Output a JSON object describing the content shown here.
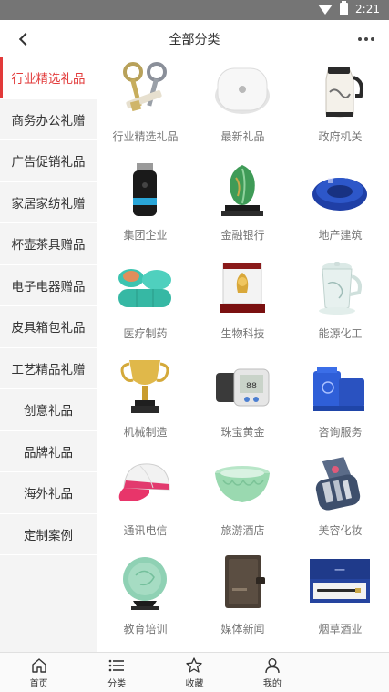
{
  "status": {
    "time": "2:21"
  },
  "header": {
    "title": "全部分类"
  },
  "sidebar": {
    "items": [
      {
        "label": "行业精选礼品",
        "active": true
      },
      {
        "label": "商务办公礼赠"
      },
      {
        "label": "广告促销礼品"
      },
      {
        "label": "家居家纺礼赠"
      },
      {
        "label": "杯壶茶具赠品"
      },
      {
        "label": "电子电器赠品"
      },
      {
        "label": "皮具箱包礼品"
      },
      {
        "label": "工艺精品礼赠"
      },
      {
        "label": "创意礼品"
      },
      {
        "label": "品牌礼品"
      },
      {
        "label": "海外礼品"
      },
      {
        "label": "定制案例"
      }
    ]
  },
  "grid": {
    "items": [
      {
        "label": "行业精选礼品",
        "icon": "keys-gift-icon"
      },
      {
        "label": "最新礼品",
        "icon": "white-device-icon"
      },
      {
        "label": "政府机关",
        "icon": "kettle-icon"
      },
      {
        "label": "集团企业",
        "icon": "usb-lighter-icon"
      },
      {
        "label": "金融银行",
        "icon": "jade-cabbage-icon"
      },
      {
        "label": "地产建筑",
        "icon": "ashtray-icon"
      },
      {
        "label": "医疗制药",
        "icon": "pill-box-icon"
      },
      {
        "label": "生物科技",
        "icon": "gold-ornament-icon"
      },
      {
        "label": "能源化工",
        "icon": "tea-cup-icon"
      },
      {
        "label": "机械制造",
        "icon": "trophy-icon"
      },
      {
        "label": "珠宝黄金",
        "icon": "blood-pressure-meter-icon"
      },
      {
        "label": "咨询服务",
        "icon": "pen-holder-icon"
      },
      {
        "label": "通讯电信",
        "icon": "cap-icon"
      },
      {
        "label": "旅游酒店",
        "icon": "green-bowl-icon"
      },
      {
        "label": "美容化妆",
        "icon": "manicure-set-icon"
      },
      {
        "label": "教育培训",
        "icon": "celadon-plate-icon"
      },
      {
        "label": "媒体新闻",
        "icon": "notebook-icon"
      },
      {
        "label": "烟草酒业",
        "icon": "pen-box-icon"
      }
    ]
  },
  "bottom_nav": {
    "items": [
      {
        "label": "首页",
        "icon": "home-icon"
      },
      {
        "label": "分类",
        "icon": "list-icon"
      },
      {
        "label": "收藏",
        "icon": "star-icon"
      },
      {
        "label": "我的",
        "icon": "user-icon"
      }
    ]
  },
  "colors": {
    "accent": "#e23a3a",
    "sidebar_bg": "#f4f4f4",
    "status_bar": "#757575"
  }
}
